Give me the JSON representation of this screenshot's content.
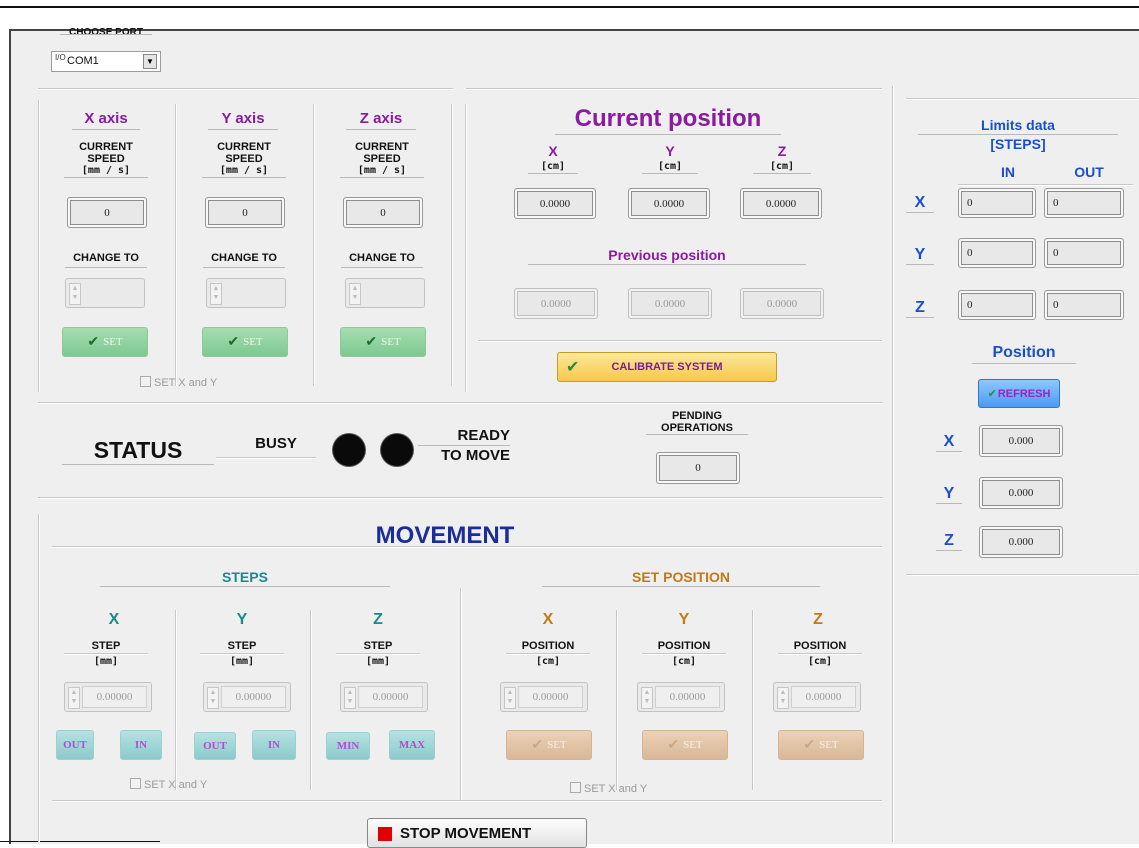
{
  "port": {
    "label": "CHOOSE PORT",
    "icon": "io-icon",
    "io_glyph": "I/O",
    "value": "COM1"
  },
  "axes": [
    {
      "title": "X axis",
      "speed_label": "CURRENT SPEED",
      "unit": "[mm / s]",
      "value": "0",
      "change_label": "CHANGE TO",
      "set": "SET"
    },
    {
      "title": "Y axis",
      "speed_label": "CURRENT SPEED",
      "unit": "[mm / s]",
      "value": "0",
      "change_label": "CHANGE TO",
      "set": "SET"
    },
    {
      "title": "Z axis",
      "speed_label": "CURRENT SPEED",
      "unit": "[mm / s]",
      "value": "0",
      "change_label": "CHANGE TO",
      "set": "SET"
    }
  ],
  "set_xy_label": "SET X and Y",
  "current_position": {
    "title": "Current position",
    "axes": [
      {
        "name": "X",
        "unit": "[cm]",
        "value": "0.0000"
      },
      {
        "name": "Y",
        "unit": "[cm]",
        "value": "0.0000"
      },
      {
        "name": "Z",
        "unit": "[cm]",
        "value": "0.0000"
      }
    ],
    "previous_title": "Previous position",
    "previous": [
      "0.0000",
      "0.0000",
      "0.0000"
    ],
    "calibrate": "CALIBRATE SYSTEM"
  },
  "status": {
    "title": "STATUS",
    "busy": "BUSY",
    "ready_line1": "READY",
    "ready_line2": "TO MOVE",
    "pending_label": "PENDING OPERATIONS",
    "pending_value": "0"
  },
  "movement": {
    "title": "MOVEMENT",
    "steps_title": "STEPS",
    "set_position_title": "SET POSITION",
    "steps": [
      {
        "axis": "X",
        "label": "STEP",
        "unit": "[mm]",
        "value": "0.00000",
        "btn1": "OUT",
        "btn2": "IN"
      },
      {
        "axis": "Y",
        "label": "STEP",
        "unit": "[mm]",
        "value": "0.00000",
        "btn1": "OUT",
        "btn2": "IN"
      },
      {
        "axis": "Z",
        "label": "STEP",
        "unit": "[mm]",
        "value": "0.00000",
        "btn1": "MIN",
        "btn2": "MAX"
      }
    ],
    "positions": [
      {
        "axis": "X",
        "label": "POSITION",
        "unit": "[cm]",
        "value": "0.00000",
        "set": "SET"
      },
      {
        "axis": "Y",
        "label": "POSITION",
        "unit": "[cm]",
        "value": "0.00000",
        "set": "SET"
      },
      {
        "axis": "Z",
        "label": "POSITION",
        "unit": "[cm]",
        "value": "0.00000",
        "set": "SET"
      }
    ],
    "set_xy_steps": "SET X and Y",
    "set_xy_pos": "SET X and Y",
    "stop": "STOP MOVEMENT"
  },
  "limits": {
    "title_line1": "Limits data",
    "title_line2": "[STEPS]",
    "in": "IN",
    "out": "OUT",
    "rows": [
      {
        "axis": "X",
        "in": "0",
        "out": "0"
      },
      {
        "axis": "Y",
        "in": "0",
        "out": "0"
      },
      {
        "axis": "Z",
        "in": "0",
        "out": "0"
      }
    ]
  },
  "position_panel": {
    "title": "Position",
    "refresh": "REFRESH",
    "rows": [
      {
        "axis": "X",
        "value": "0.000"
      },
      {
        "axis": "Y",
        "value": "0.000"
      },
      {
        "axis": "Z",
        "value": "0.000"
      }
    ]
  },
  "colors": {
    "purple": "#8a1aa0",
    "blue": "#1b4fc9",
    "teal": "#1a8a8a",
    "orange": "#c07a18",
    "navy": "#1a2e9a",
    "stop_red": "#e00000"
  }
}
